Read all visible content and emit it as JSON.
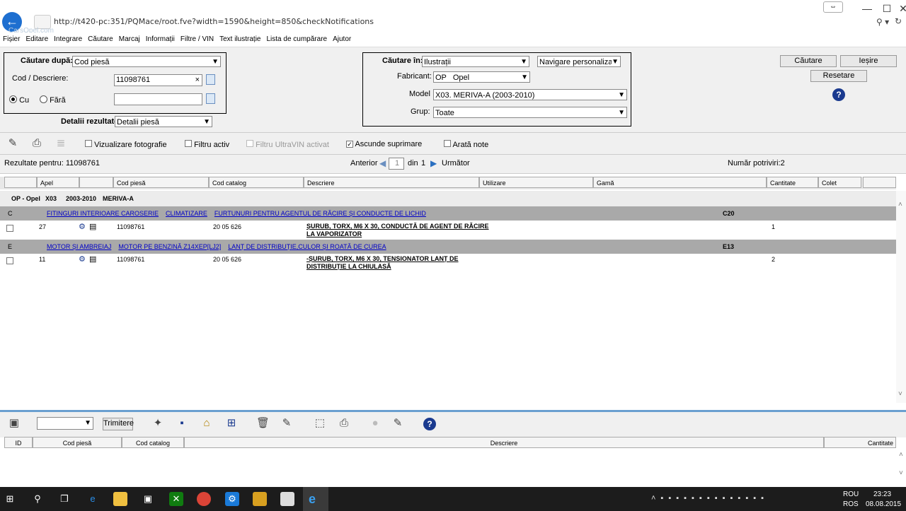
{
  "browser": {
    "url": "http://t420-pc:351/PQMace/root.fve?width=1590&height=850&checkNotifications",
    "watermark": "CarsOpel.com"
  },
  "menu": [
    "Fișier",
    "Editare",
    "Integrare",
    "Căutare",
    "Marcaj",
    "Informații",
    "Filtre / VIN",
    "Text ilustrație",
    "Lista de cumpărare",
    "Ajutor"
  ],
  "search": {
    "search_by_label": "Căutare după:",
    "search_by_value": "Cod piesă",
    "code_desc_label": "Cod / Descriere:",
    "code_value": "11098761",
    "with_label": "Cu",
    "without_label": "Fără",
    "result_details_label": "Detalii rezultate:",
    "result_details_value": "Detalii piesă",
    "search_in_label": "Căutare în:",
    "search_in_value": "Ilustrații",
    "nav_value": "Navigare personalizat",
    "manufacturer_label": "Fabricant:",
    "manufacturer_value": "OP   Opel",
    "model_label": "Model",
    "model_value": "X03. MERIVA-A (2003-2010)",
    "group_label": "Grup:",
    "group_value": "Toate",
    "btn_search": "Căutare",
    "btn_exit": "Ieșire",
    "btn_reset": "Resetare"
  },
  "toolbar": {
    "show_photos": "Vizualizare fotografie",
    "active_filter": "Filtru activ",
    "ultravin_filter": "Filtru UltraVIN activat",
    "hide_deletion": "Ascunde suprimare",
    "show_notes": "Arată note"
  },
  "results": {
    "results_for": "Rezultate pentru: 11098761",
    "previous": "Anterior",
    "page": "1",
    "of": "din",
    "total_pages": "1",
    "next": "Următor",
    "match_count": "Număr potriviri:2"
  },
  "columns": [
    "Apel",
    "Cod piesă",
    "Cod catalog",
    "Descriere",
    "Utilizare",
    "Gamă",
    "Cantitate",
    "Colet"
  ],
  "vehicle": {
    "make": "OP - Opel",
    "code": "X03",
    "years": "2003-2010",
    "model": "MERIVA-A"
  },
  "groups": [
    {
      "letter": "C",
      "path": [
        "FITINGURI INTERIOARE CAROSERIE",
        "CLIMATIZARE",
        "FURTUNURI PENTRU AGENTUL DE RĂCIRE ȘI CONDUCTE DE LICHID"
      ],
      "range": "C20",
      "part": {
        "call": "27",
        "part_no": "11098761",
        "catalog": "20 05 626",
        "desc_line1": "ȘURUB, TORX, M6 X 30, CONDUCTĂ DE AGENT DE RĂCIRE",
        "desc_line2": "LA VAPORIZATOR",
        "qty": "1"
      }
    },
    {
      "letter": "E",
      "path": [
        "MOTOR ȘI AMBREIAJ",
        "MOTOR PE BENZINĂ Z14XEP[LJ2]",
        "LANȚ DE DISTRIBUȚIE,CULOR ȘI ROATĂ DE CUREA"
      ],
      "range": "E13",
      "part": {
        "call": "11",
        "part_no": "11098761",
        "catalog": "20 05 626",
        "desc_line1": "-ȘURUB, TORX, M6 X 30, TENSIONATOR LANȚ DE",
        "desc_line2": "DISTRIBUȚIE LA CHIULASĂ",
        "qty": "2"
      }
    }
  ],
  "bottom": {
    "send": "Trimitere",
    "columns": [
      "ID",
      "Cod piesă",
      "Cod catalog",
      "Descriere",
      "Cantitate"
    ]
  },
  "taskbar": {
    "lang1": "ROU",
    "lang2": "ROS",
    "time": "23:23",
    "date": "08.08.2015"
  }
}
